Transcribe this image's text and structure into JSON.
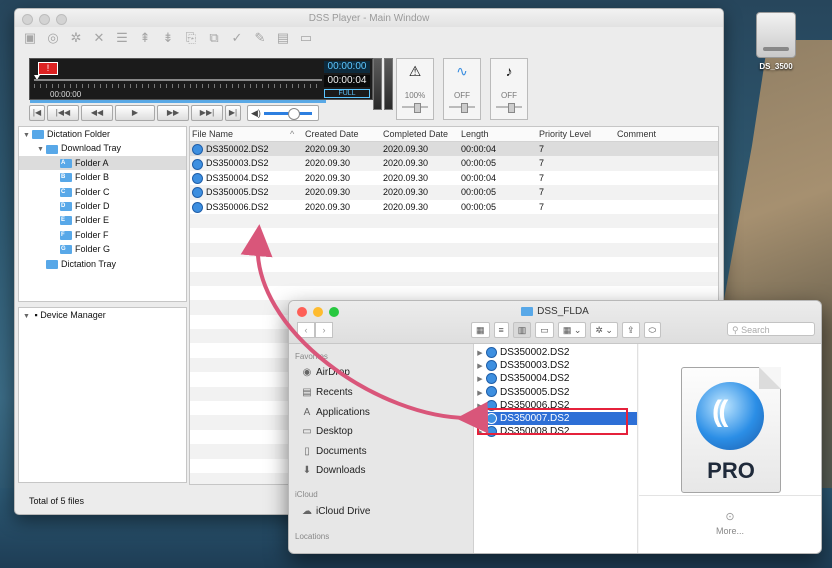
{
  "desktop": {
    "drive_label": "DS_3500"
  },
  "main_window": {
    "title": "DSS Player - Main Window",
    "transport": {
      "alert_glyph": "!",
      "position_time": "00:00:00",
      "clock_top": "00:00:00",
      "clock_bottom": "00:00:04",
      "full_label": "FULL",
      "buttons": [
        "|◀",
        "|◀◀",
        "◀◀",
        "▶",
        "▶▶",
        "▶▶|",
        "▶|"
      ],
      "volume_level": 0.55
    },
    "controls": [
      {
        "name": "speed",
        "value": "100%"
      },
      {
        "name": "noise",
        "value": "OFF"
      },
      {
        "name": "tone",
        "value": "OFF"
      }
    ],
    "tree": [
      {
        "label": "Dictation Folder",
        "indent": 0,
        "expanded": true,
        "letter": ""
      },
      {
        "label": "Download Tray",
        "indent": 1,
        "expanded": true,
        "letter": ""
      },
      {
        "label": "Folder A",
        "indent": 2,
        "letter": "A",
        "selected": true
      },
      {
        "label": "Folder B",
        "indent": 2,
        "letter": "B"
      },
      {
        "label": "Folder C",
        "indent": 2,
        "letter": "C"
      },
      {
        "label": "Folder D",
        "indent": 2,
        "letter": "D"
      },
      {
        "label": "Folder E",
        "indent": 2,
        "letter": "E"
      },
      {
        "label": "Folder F",
        "indent": 2,
        "letter": "F"
      },
      {
        "label": "Folder G",
        "indent": 2,
        "letter": "G"
      },
      {
        "label": "Dictation Tray",
        "indent": 1,
        "letter": ""
      }
    ],
    "device_manager_label": "Device Manager",
    "columns": [
      "File Name",
      "Created Date",
      "Completed Date",
      "Length",
      "Priority Level",
      "Comment"
    ],
    "sort_glyph": "^",
    "rows": [
      [
        "DS350002.DS2",
        "2020.09.30",
        "2020.09.30",
        "00:00:04",
        "7",
        ""
      ],
      [
        "DS350003.DS2",
        "2020.09.30",
        "2020.09.30",
        "00:00:05",
        "7",
        ""
      ],
      [
        "DS350004.DS2",
        "2020.09.30",
        "2020.09.30",
        "00:00:04",
        "7",
        ""
      ],
      [
        "DS350005.DS2",
        "2020.09.30",
        "2020.09.30",
        "00:00:05",
        "7",
        ""
      ],
      [
        "DS350006.DS2",
        "2020.09.30",
        "2020.09.30",
        "00:00:05",
        "7",
        ""
      ]
    ],
    "status": "Total of 5 files"
  },
  "finder": {
    "title": "DSS_FLDA",
    "search_placeholder": "Search",
    "sidebar": {
      "favorites_header": "Favorites",
      "favorites": [
        "AirDrop",
        "Recents",
        "Applications",
        "Desktop",
        "Documents",
        "Downloads"
      ],
      "icloud_header": "iCloud",
      "icloud": [
        "iCloud Drive"
      ],
      "locations_header": "Locations"
    },
    "files": [
      "DS350002.DS2",
      "DS350003.DS2",
      "DS350004.DS2",
      "DS350005.DS2",
      "DS350006.DS2",
      "DS350007.DS2",
      "DS350008.DS2"
    ],
    "selected_file": "DS350007.DS2",
    "preview_text": "PRO",
    "more_label": "More..."
  },
  "colors": {
    "selection": "#2d6fd6",
    "highlight_box": "#e5213b",
    "arrow": "#d9567a",
    "folder": "#58a8e8"
  }
}
